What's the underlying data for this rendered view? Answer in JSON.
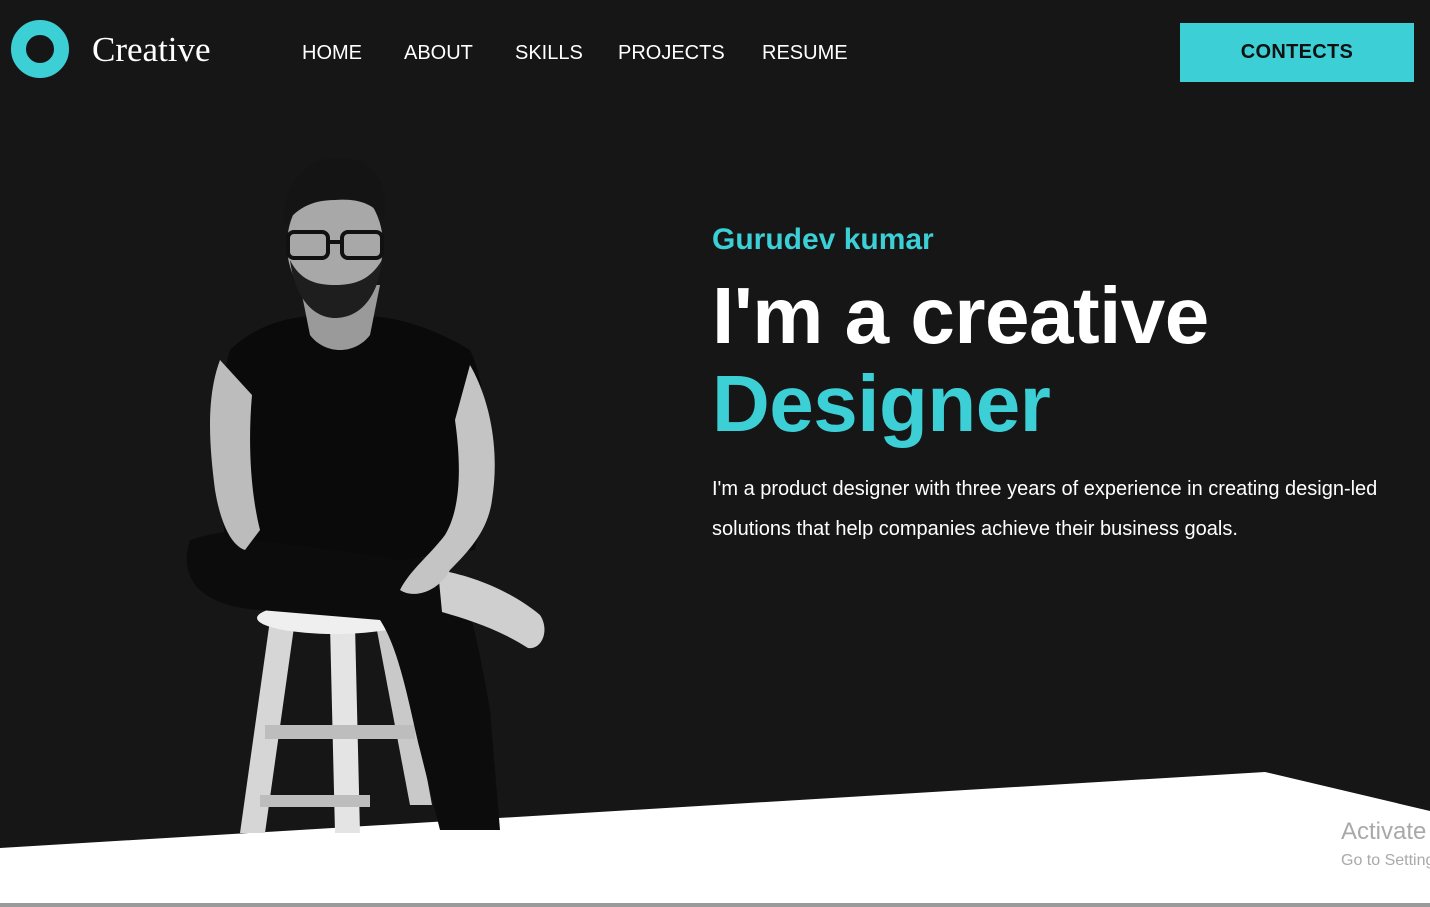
{
  "header": {
    "brand": "Creative",
    "nav": [
      "HOME",
      "ABOUT",
      "SKILLS",
      "PROJECTS",
      "RESUME"
    ],
    "cta_label": "CONTECTS"
  },
  "hero": {
    "name": "Gurudev kumar",
    "headline": "I'm a creative",
    "headline_accent": "Designer",
    "bio": "I'm a product designer with three years of experience in creating design-led solutions that help companies achieve their business goals."
  },
  "watermark": {
    "title": "Activate Windows",
    "subtitle": "Go to Settings to activate Windows."
  },
  "colors": {
    "accent": "#3ccfd6",
    "background": "#161616",
    "text": "#ffffff"
  }
}
